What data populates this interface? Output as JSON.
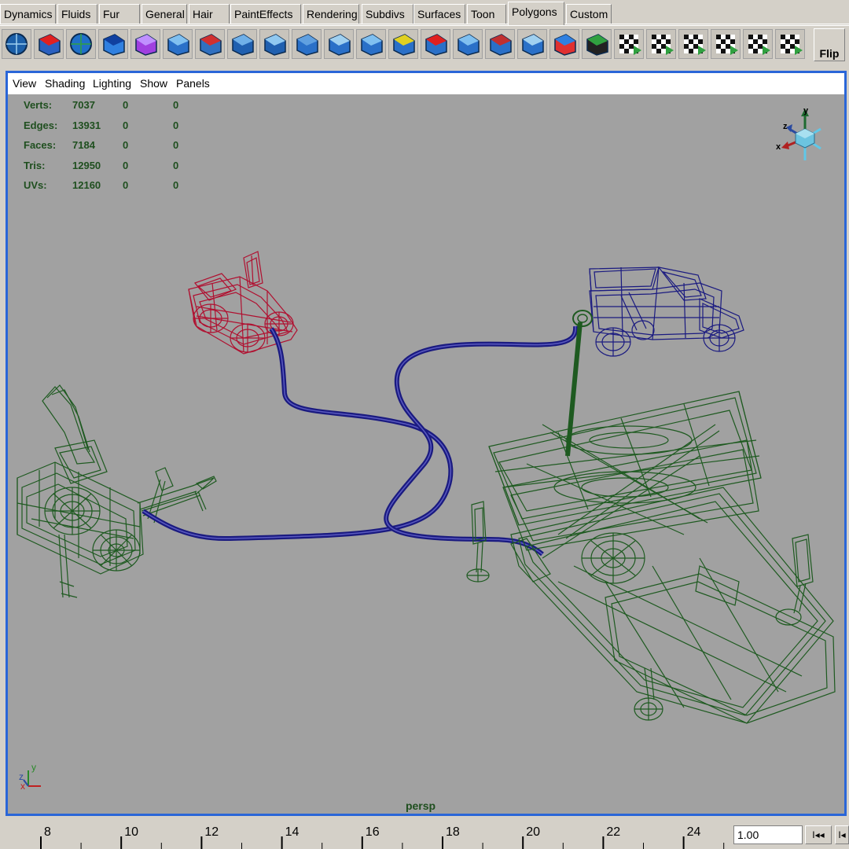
{
  "shelf": {
    "tabs": [
      {
        "label": "Dynamics",
        "active": false
      },
      {
        "label": "Fluids",
        "active": false
      },
      {
        "label": "Fur",
        "active": false
      },
      {
        "label": "General",
        "active": false
      },
      {
        "label": "Hair",
        "active": false
      },
      {
        "label": "PaintEffects",
        "active": false
      },
      {
        "label": "Rendering",
        "active": false
      },
      {
        "label": "Subdivs",
        "active": false
      },
      {
        "label": "Surfaces",
        "active": false
      },
      {
        "label": "Toon",
        "active": false
      },
      {
        "label": "Polygons",
        "active": true
      },
      {
        "label": "Custom",
        "active": false
      }
    ],
    "tools": [
      {
        "icon": "sphere-icon"
      },
      {
        "icon": "cube-grid-icon"
      },
      {
        "icon": "sphere-split-icon"
      },
      {
        "icon": "cube-sphere-icon"
      },
      {
        "icon": "purple-cube-icon"
      },
      {
        "icon": "extrude-face-icon"
      },
      {
        "icon": "cut-faces-icon"
      },
      {
        "icon": "extrude-edge-icon"
      },
      {
        "icon": "bevel-icon"
      },
      {
        "icon": "extrude-vertex-icon"
      },
      {
        "icon": "box-icon"
      },
      {
        "icon": "split-polygon-icon"
      },
      {
        "icon": "wedge-face-icon"
      },
      {
        "icon": "smooth-icon"
      },
      {
        "icon": "merge-edge-icon"
      },
      {
        "icon": "triangulate-icon"
      },
      {
        "icon": "append-polygon-icon"
      },
      {
        "icon": "quadrangulate-icon"
      },
      {
        "icon": "poke-face-icon"
      },
      {
        "icon": "checker-uv-icon"
      },
      {
        "icon": "uv-map-icon"
      },
      {
        "icon": "cylindrical-map-icon"
      },
      {
        "icon": "spherical-map-icon"
      },
      {
        "icon": "automatic-map-icon"
      },
      {
        "icon": "uv-editor-icon"
      }
    ],
    "flip_label": "Flip"
  },
  "panel": {
    "menu": [
      "View",
      "Shading",
      "Lighting",
      "Show",
      "Panels"
    ],
    "camera": "persp",
    "stats": [
      {
        "label": "Verts:",
        "total": "7037",
        "selected": "0",
        "highlighted": "0"
      },
      {
        "label": "Edges:",
        "total": "13931",
        "selected": "0",
        "highlighted": "0"
      },
      {
        "label": "Faces:",
        "total": "7184",
        "selected": "0",
        "highlighted": "0"
      },
      {
        "label": "Tris:",
        "total": "12950",
        "selected": "0",
        "highlighted": "0"
      },
      {
        "label": "UVs:",
        "total": "12160",
        "selected": "0",
        "highlighted": "0"
      }
    ],
    "view_cube_axes": {
      "y": "y",
      "z": "z",
      "x": "x"
    },
    "corner_axes": {
      "y": "y",
      "z": "z",
      "x": "x"
    },
    "colors": {
      "viewport_bg": "#a1a1a1",
      "wire_green": "#1e5a20",
      "wire_red": "#b01030",
      "wire_blue": "#1a1a80",
      "panel_border": "#2a66d8"
    }
  },
  "timeline": {
    "ticks": [
      "8",
      "10",
      "12",
      "14",
      "16",
      "18",
      "20",
      "22",
      "24"
    ],
    "current_time": "1.00",
    "step_back_label": "I◂◂",
    "go_start_label": "I◂"
  }
}
